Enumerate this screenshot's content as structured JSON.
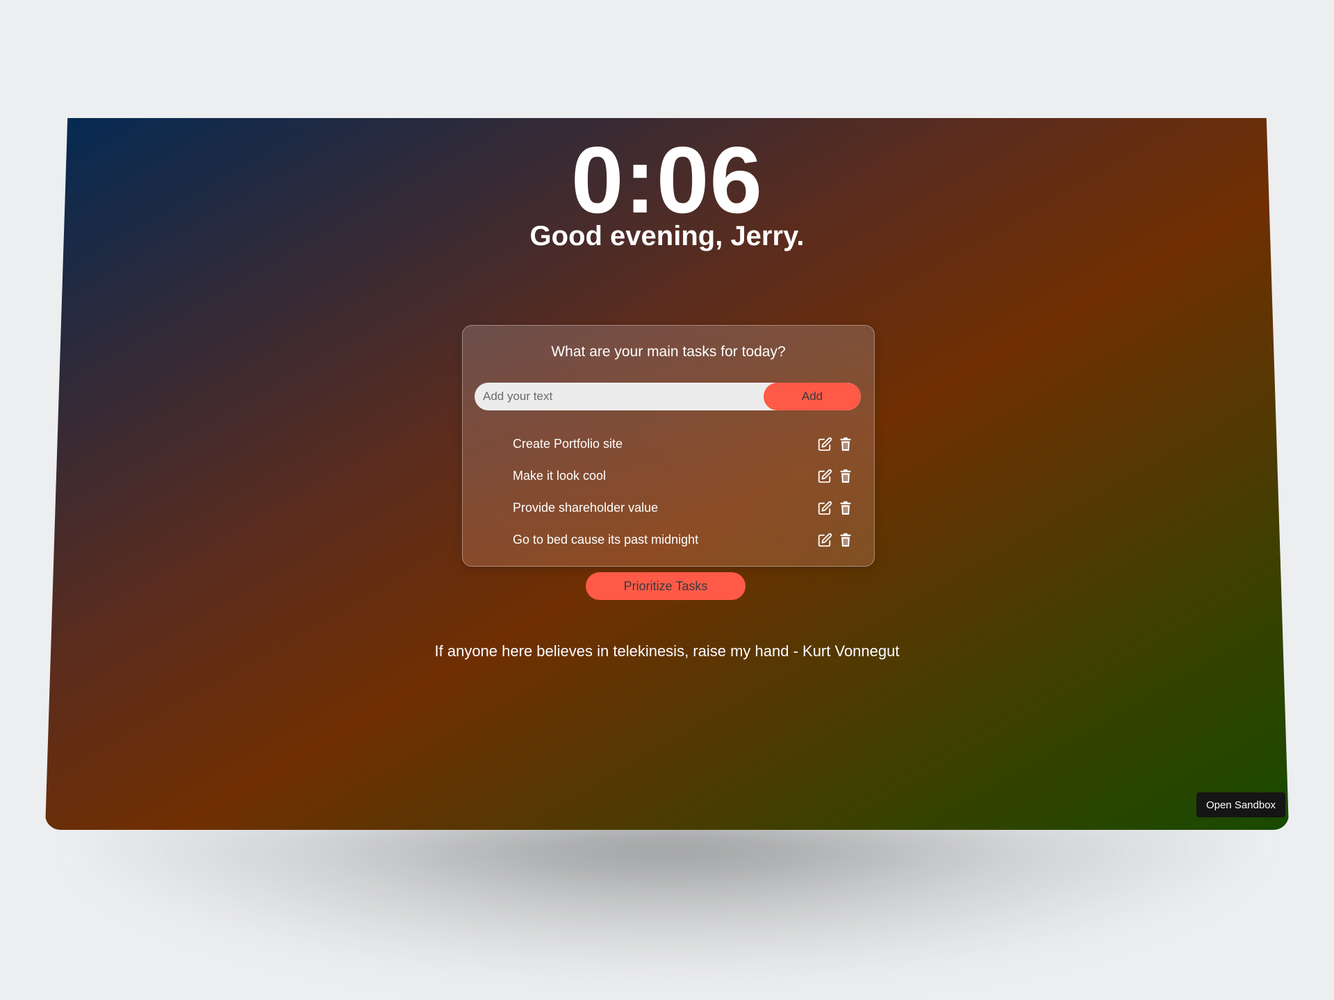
{
  "clock": {
    "time": "0:06"
  },
  "greeting": "Good evening, Jerry.",
  "tasks": {
    "question": "What are your main tasks for today?",
    "input_placeholder": "Add your text",
    "add_label": "Add",
    "items": [
      {
        "label": "Create Portfolio site"
      },
      {
        "label": "Make it look cool"
      },
      {
        "label": "Provide shareholder value"
      },
      {
        "label": "Go to bed cause its past midnight"
      }
    ],
    "edit_icon": "edit-icon",
    "delete_icon": "trash-icon"
  },
  "prioritize_label": "Prioritize Tasks",
  "quote": "If anyone here believes in telekinesis, raise my hand - Kurt Vonnegut",
  "sandbox_label": "Open Sandbox",
  "colors": {
    "accent": "#ff5a48",
    "text": "#ffffff",
    "sandbox_bg": "#151515"
  }
}
